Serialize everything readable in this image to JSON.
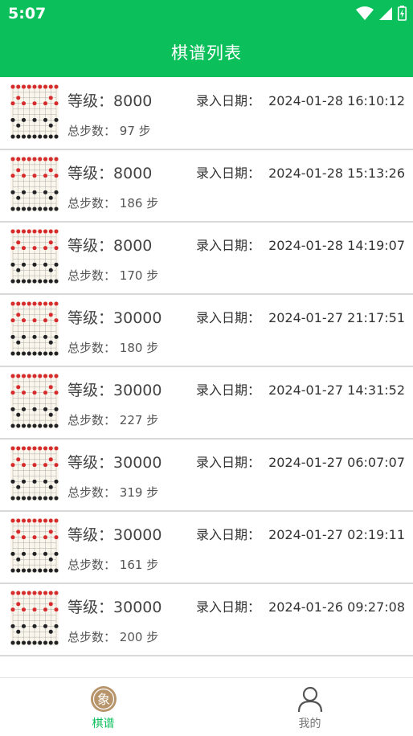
{
  "status": {
    "time": "5:07"
  },
  "header": {
    "title": "棋谱列表"
  },
  "labels": {
    "level_prefix": "等级：",
    "date_prefix": "录入日期：",
    "steps_prefix": "总步数：",
    "steps_suffix": "步"
  },
  "records": [
    {
      "level": "8000",
      "date": "2024-01-28 16:10:12",
      "steps": "97"
    },
    {
      "level": "8000",
      "date": "2024-01-28 15:13:26",
      "steps": "186"
    },
    {
      "level": "8000",
      "date": "2024-01-28 14:19:07",
      "steps": "170"
    },
    {
      "level": "30000",
      "date": "2024-01-27 21:17:51",
      "steps": "180"
    },
    {
      "level": "30000",
      "date": "2024-01-27 14:31:52",
      "steps": "227"
    },
    {
      "level": "30000",
      "date": "2024-01-27 06:07:07",
      "steps": "319"
    },
    {
      "level": "30000",
      "date": "2024-01-27 02:19:11",
      "steps": "161"
    },
    {
      "level": "30000",
      "date": "2024-01-26 09:27:08",
      "steps": "200"
    }
  ],
  "nav": [
    {
      "label": "棋谱",
      "icon": "chess-elephant-icon",
      "glyph": "象",
      "active": true
    },
    {
      "label": "我的",
      "icon": "person-icon",
      "active": false
    }
  ],
  "colors": {
    "primary": "#0bbf5b",
    "red_piece": "#d62b2b",
    "black_piece": "#222222"
  }
}
